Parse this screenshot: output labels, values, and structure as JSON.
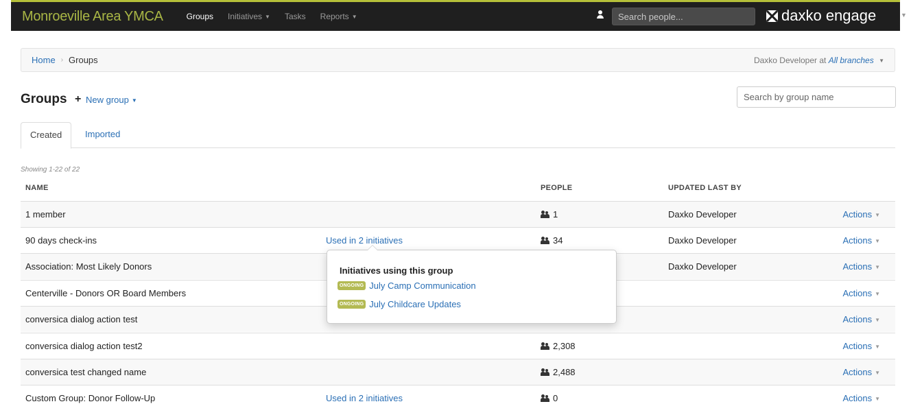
{
  "topbar": {
    "brand": "Monroeville Area YMCA",
    "nav": [
      {
        "label": "Groups"
      },
      {
        "label": "Initiatives"
      },
      {
        "label": "Tasks"
      },
      {
        "label": "Reports"
      }
    ],
    "search_placeholder": "Search people...",
    "logo_text": "daxko engage",
    "accent_color": "#b5bf39"
  },
  "breadcrumb": {
    "home": "Home",
    "current": "Groups",
    "user_prefix": "Daxko Developer at",
    "branch": "All branches"
  },
  "header": {
    "title": "Groups",
    "plus": "+",
    "new_group": "New group",
    "search_placeholder": "Search by group name"
  },
  "tabs": [
    {
      "label": "Created",
      "active": true
    },
    {
      "label": "Imported",
      "active": false
    }
  ],
  "table": {
    "showing": "Showing 1-22 of 22",
    "headers": {
      "name": "NAME",
      "people": "PEOPLE",
      "updated": "UPDATED LAST BY"
    },
    "rows": [
      {
        "name": "1 member",
        "used": "",
        "people": "1",
        "updated": "Daxko Developer",
        "actions": "Actions"
      },
      {
        "name": "90 days check-ins",
        "used": "Used in 2 initiatives",
        "people": "34",
        "updated": "Daxko Developer",
        "actions": "Actions"
      },
      {
        "name": "Association: Most Likely Donors",
        "used": "",
        "people": "",
        "updated": "Daxko Developer",
        "actions": "Actions"
      },
      {
        "name": "Centerville - Donors OR Board Members",
        "used": "",
        "people": "",
        "updated": "",
        "actions": "Actions"
      },
      {
        "name": "conversica dialog action test",
        "used": "",
        "people": "",
        "updated": "",
        "actions": "Actions"
      },
      {
        "name": "conversica dialog action test2",
        "used": "",
        "people": "2,308",
        "updated": "",
        "actions": "Actions"
      },
      {
        "name": "conversica test changed name",
        "used": "",
        "people": "2,488",
        "updated": "",
        "actions": "Actions"
      },
      {
        "name": "Custom Group: Donor Follow-Up",
        "used": "Used in 2 initiatives",
        "people": "0",
        "updated": "",
        "actions": "Actions"
      }
    ]
  },
  "popover": {
    "title": "Initiatives using this group",
    "items": [
      {
        "badge": "ONGOING",
        "label": "July Camp Communication"
      },
      {
        "badge": "ONGOING",
        "label": "July Childcare Updates"
      }
    ]
  }
}
